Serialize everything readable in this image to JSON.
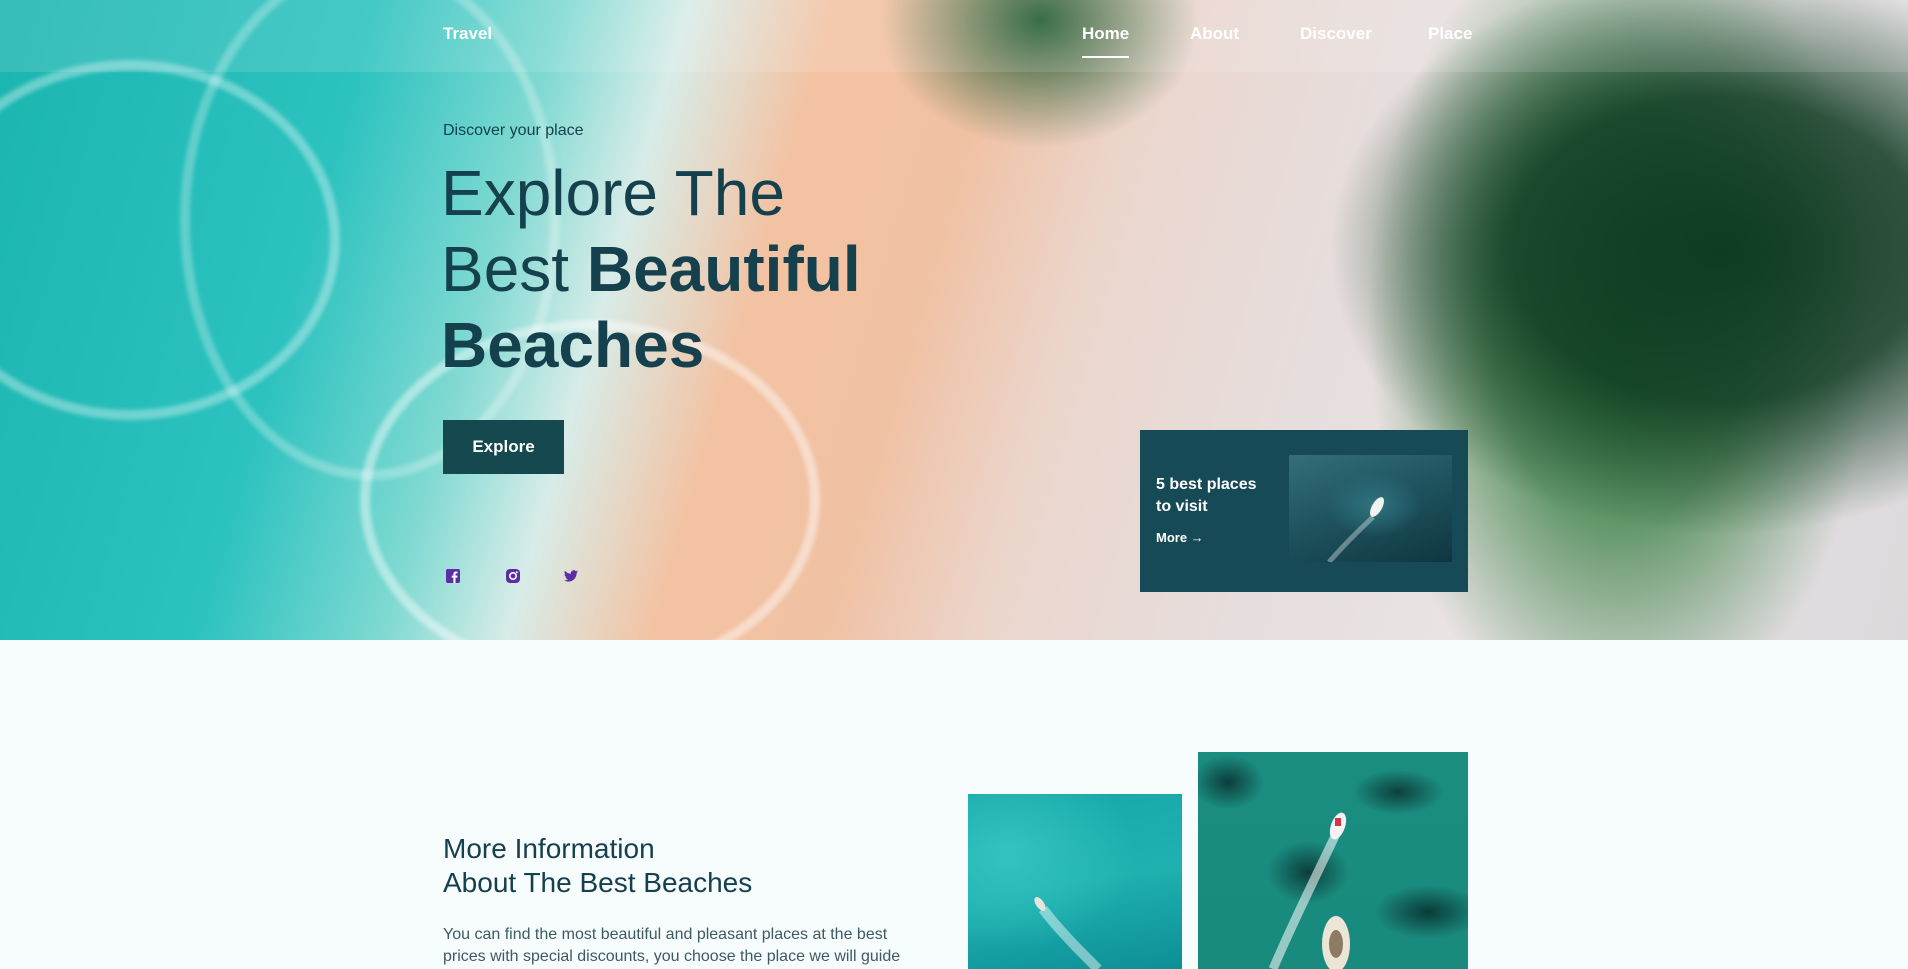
{
  "header": {
    "brand": "Travel",
    "nav": [
      {
        "label": "Home",
        "active": true
      },
      {
        "label": "About",
        "active": false
      },
      {
        "label": "Discover",
        "active": false
      },
      {
        "label": "Place",
        "active": false
      }
    ]
  },
  "hero": {
    "kicker": "Discover your place",
    "headline_line1": "Explore The",
    "headline_line2_regular": "Best ",
    "headline_line2_bold": "Beautiful",
    "headline_line3": "Beaches",
    "button_label": "Explore",
    "social_icons": [
      "facebook-icon",
      "instagram-icon",
      "twitter-icon"
    ]
  },
  "card": {
    "title": "5 best places to visit",
    "more_label": "More →"
  },
  "info": {
    "title_line1": "More Information",
    "title_line2": "About The Best Beaches",
    "text": "You can find the most beautiful and pleasant places at the best prices with special discounts, you choose the place we will guide"
  },
  "colors": {
    "primary_dark": "#15484f",
    "card_bg": "#174a57",
    "text_dark": "#15404d",
    "icon_purple": "#5b2fa3",
    "page_bg": "#f7fcfd"
  }
}
